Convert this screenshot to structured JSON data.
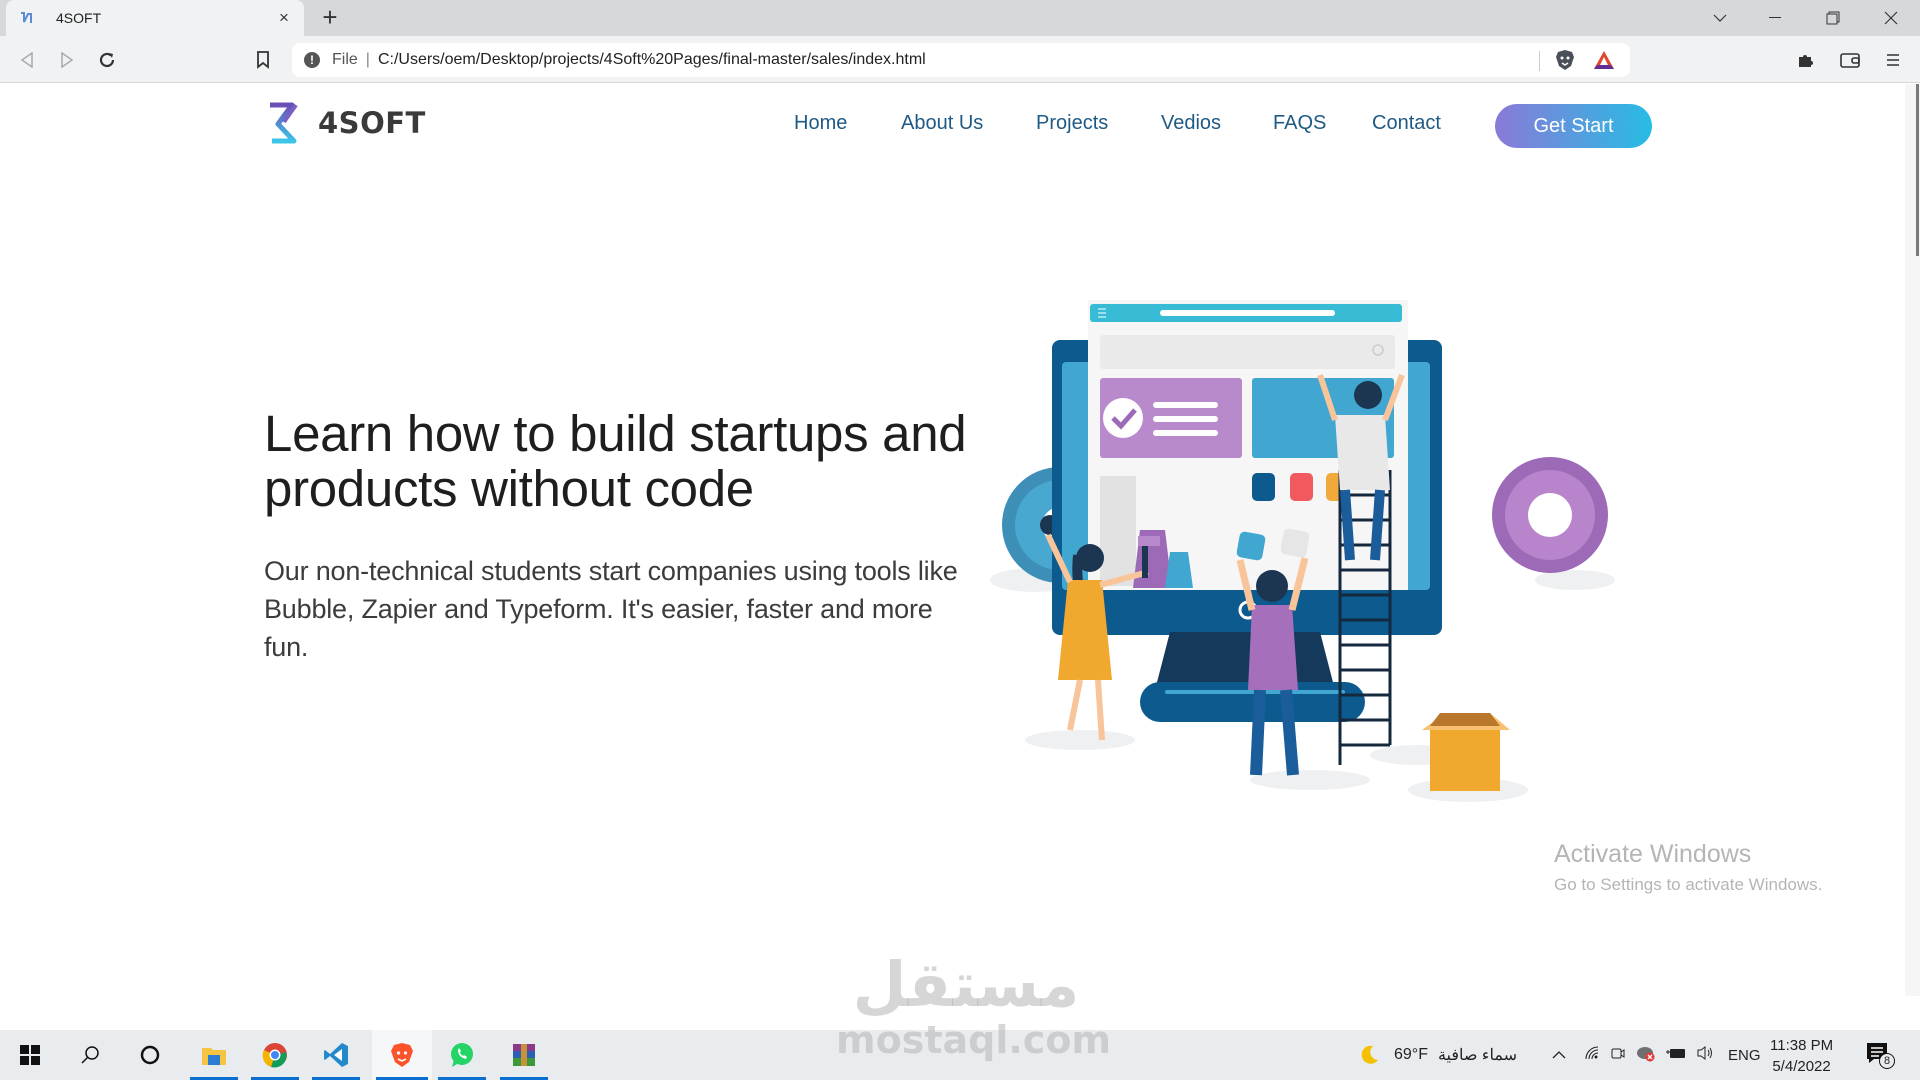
{
  "browser": {
    "tab_title": "4SOFT",
    "tab_close": "×",
    "new_tab": "+",
    "address": {
      "scheme_label": "File",
      "separator": "|",
      "url": "C:/Users/oem/Desktop/projects/4Soft%20Pages/final-master/sales/index.html"
    },
    "window_controls": [
      "tab-search",
      "minimize",
      "restore",
      "close"
    ]
  },
  "site": {
    "brand": "4SOFT",
    "nav": [
      {
        "label": "Home"
      },
      {
        "label": "About Us"
      },
      {
        "label": "Projects"
      },
      {
        "label": "Vedios"
      },
      {
        "label": "FAQS"
      },
      {
        "label": "Contact"
      }
    ],
    "cta_label": "Get Start",
    "colors": {
      "nav_link": "#1f5a84",
      "cta_gradient_start": "#8a7ad8",
      "cta_gradient_end": "#27bce4"
    },
    "hero": {
      "title": "Learn how to build startups and products without code",
      "subtitle": "Our non-technical students start companies using tools like Bubble, Zapier and Typeform. It's easier, faster and more fun.",
      "illustration": "people-building-website-on-monitor"
    }
  },
  "overlay": {
    "activate_title": "Activate Windows",
    "activate_sub": "Go to Settings to activate Windows.",
    "watermark_ar": "مستقل",
    "watermark_en": "mostaql.com"
  },
  "taskbar": {
    "apps": [
      "start",
      "search",
      "cortana",
      "file-explorer",
      "chrome",
      "vscode",
      "brave",
      "whatsapp",
      "winrar"
    ],
    "weather_temp": "69°F",
    "weather_desc": "سماء صافية",
    "language": "ENG",
    "time": "11:38 PM",
    "date": "5/4/2022",
    "notifications_count": "8"
  }
}
